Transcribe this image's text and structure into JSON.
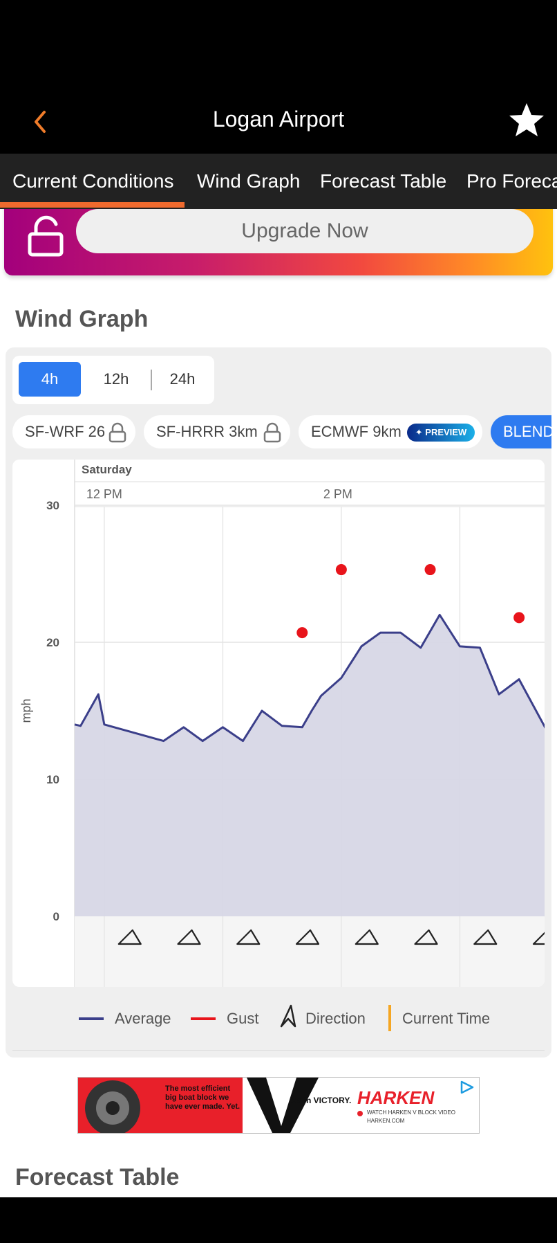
{
  "header": {
    "title": "Logan Airport"
  },
  "tabs": [
    {
      "label": "Current Conditions"
    },
    {
      "label": "Wind Graph"
    },
    {
      "label": "Forecast Table"
    },
    {
      "label": "Pro Forecast"
    }
  ],
  "upgrade": {
    "label": "Upgrade Now"
  },
  "wind_graph": {
    "title": "Wind Graph",
    "ranges": [
      "4h",
      "12h",
      "24h"
    ],
    "active_range": "4h",
    "models": [
      {
        "label": "SF-WRF 26",
        "locked": true
      },
      {
        "label": "SF-HRRR 3km",
        "locked": true
      },
      {
        "label": "ECMWF 9km",
        "badge": "✦ PREVIEW"
      },
      {
        "label": "BLEND"
      }
    ],
    "legend": {
      "average": "Average",
      "gust": "Gust",
      "direction": "Direction",
      "current_time": "Current Time"
    }
  },
  "chart_data": {
    "type": "line",
    "day_label": "Saturday",
    "x_ticks": [
      "12 PM",
      "2 PM"
    ],
    "ylabel": "mph",
    "y_ticks": [
      0,
      10,
      20,
      30
    ],
    "ylim": [
      0,
      30
    ],
    "xlim_hours": [
      11.75,
      15.75
    ],
    "series": [
      {
        "name": "Average",
        "color": "#3b3f8a",
        "x": [
          11.75,
          11.8,
          11.95,
          12.0,
          12.5,
          12.67,
          12.83,
          13.0,
          13.17,
          13.33,
          13.5,
          13.67,
          13.75,
          13.83,
          14.0,
          14.17,
          14.33,
          14.5,
          14.67,
          14.83,
          15.0,
          15.17,
          15.33,
          15.5,
          15.75
        ],
        "values": [
          14,
          13.9,
          16.2,
          14.0,
          12.8,
          13.8,
          12.8,
          13.8,
          12.8,
          15.0,
          13.9,
          13.8,
          15.0,
          16.1,
          17.4,
          19.7,
          20.7,
          20.7,
          19.6,
          22.0,
          19.7,
          19.6,
          16.2,
          17.3,
          13.3
        ]
      },
      {
        "name": "Gust",
        "color": "#e8141b",
        "type": "scatter",
        "x": [
          13.67,
          14.0,
          14.0,
          15.5
        ],
        "values": [
          20.7,
          25.3,
          25.3,
          21.8
        ]
      }
    ],
    "direction_arrows_count": 8,
    "direction": "wind direction arrows along x-axis"
  },
  "ad": {
    "tagline": "The most efficient big boat block we have ever made. Yet.",
    "big_letter": "V.",
    "as_in": "As in VICTORY.",
    "brand": "HARKEN",
    "cta": "WATCH HARKEN V BLOCK VIDEO",
    "url": "HARKEN.COM"
  },
  "forecast_table": {
    "title": "Forecast Table"
  }
}
